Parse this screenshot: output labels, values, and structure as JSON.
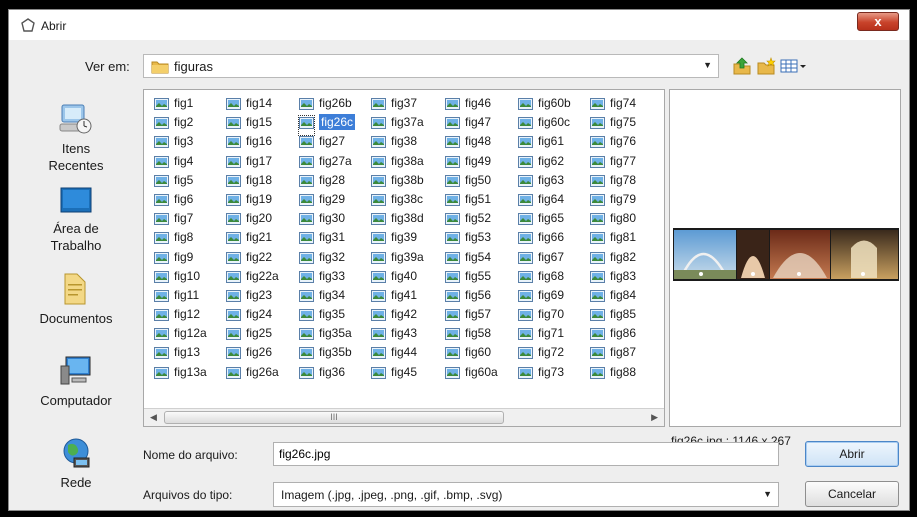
{
  "window": {
    "title": "Abrir",
    "close_label": "x"
  },
  "look_in": {
    "label": "Ver em:",
    "folder": "figuras"
  },
  "toolbar": {
    "up_icon": "up-folder-icon",
    "new_folder_icon": "new-folder-icon",
    "view_menu_icon": "view-menu-icon"
  },
  "places": [
    {
      "name": "place-recent-items",
      "icon": "recent-items-icon",
      "label": "Itens\nRecentes"
    },
    {
      "name": "place-desktop",
      "icon": "desktop-icon",
      "label": "Área de\nTrabalho"
    },
    {
      "name": "place-documents",
      "icon": "documents-icon",
      "label": "Documentos"
    },
    {
      "name": "place-computer",
      "icon": "computer-icon",
      "label": "Computador"
    },
    {
      "name": "place-network",
      "icon": "network-icon",
      "label": "Rede"
    }
  ],
  "files": {
    "columns": [
      [
        "fig1",
        "fig2",
        "fig3",
        "fig4",
        "fig5",
        "fig6",
        "fig7",
        "fig8",
        "fig9",
        "fig10",
        "fig11",
        "fig12",
        "fig12a",
        "fig13",
        "fig13a"
      ],
      [
        "fig14",
        "fig15",
        "fig16",
        "fig17",
        "fig18",
        "fig19",
        "fig20",
        "fig21",
        "fig22",
        "fig22a",
        "fig23",
        "fig24",
        "fig25",
        "fig26",
        "fig26a"
      ],
      [
        "fig26b",
        "fig26c",
        "fig27",
        "fig27a",
        "fig28",
        "fig29",
        "fig30",
        "fig31",
        "fig32",
        "fig33",
        "fig34",
        "fig35",
        "fig35a",
        "fig35b",
        "fig36"
      ],
      [
        "fig37",
        "fig37a",
        "fig38",
        "fig38a",
        "fig38b",
        "fig38c",
        "fig38d",
        "fig39",
        "fig39a",
        "fig40",
        "fig41",
        "fig42",
        "fig43",
        "fig44",
        "fig45"
      ],
      [
        "fig46",
        "fig47",
        "fig48",
        "fig49",
        "fig50",
        "fig51",
        "fig52",
        "fig53",
        "fig54",
        "fig55",
        "fig56",
        "fig57",
        "fig58",
        "fig60",
        "fig60a"
      ],
      [
        "fig60b",
        "fig60c",
        "fig61",
        "fig62",
        "fig63",
        "fig64",
        "fig65",
        "fig66",
        "fig67",
        "fig68",
        "fig69",
        "fig70",
        "fig71",
        "fig72",
        "fig73"
      ],
      [
        "fig74",
        "fig75",
        "fig76",
        "fig77",
        "fig78",
        "fig79",
        "fig80",
        "fig81",
        "fig82",
        "fig83",
        "fig84",
        "fig85",
        "fig86",
        "fig87",
        "fig88"
      ]
    ],
    "selected": "fig26c",
    "scrollbar_grip": "III"
  },
  "preview": {
    "caption": "fig26c.jpg : 1146 x 267"
  },
  "filename": {
    "label": "Nome do arquivo:",
    "value": "fig26c.jpg"
  },
  "filetype": {
    "label": "Arquivos do tipo:",
    "value": "Imagem (.jpg, .jpeg, .png, .gif, .bmp, .svg)"
  },
  "buttons": {
    "open": "Abrir",
    "cancel": "Cancelar"
  }
}
